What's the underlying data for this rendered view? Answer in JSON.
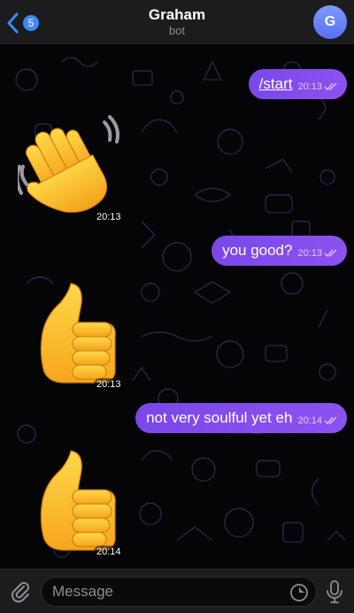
{
  "header": {
    "back_badge": "5",
    "title": "Graham",
    "subtitle": "bot",
    "avatar_initial": "G"
  },
  "messages": [
    {
      "type": "outgoing",
      "text": "/start",
      "time": "20:13",
      "is_command": true
    },
    {
      "type": "sticker",
      "emoji": "waving-hand",
      "time": "20:13"
    },
    {
      "type": "outgoing",
      "text": "you good?",
      "time": "20:13"
    },
    {
      "type": "sticker",
      "emoji": "thumbs-up",
      "time": "20:13"
    },
    {
      "type": "outgoing",
      "text": "not very soulful yet eh",
      "time": "20:14"
    },
    {
      "type": "sticker",
      "emoji": "thumbs-up",
      "time": "20:14"
    }
  ],
  "input": {
    "placeholder": "Message",
    "value": ""
  },
  "colors": {
    "accent": "#3e88f7",
    "bubble": "#8050ee",
    "background": "#000000",
    "bar": "#1c1c1e"
  },
  "icons": [
    "back-chevron-icon",
    "paperclip-icon",
    "sticker-icon",
    "microphone-icon",
    "double-check-icon"
  ]
}
